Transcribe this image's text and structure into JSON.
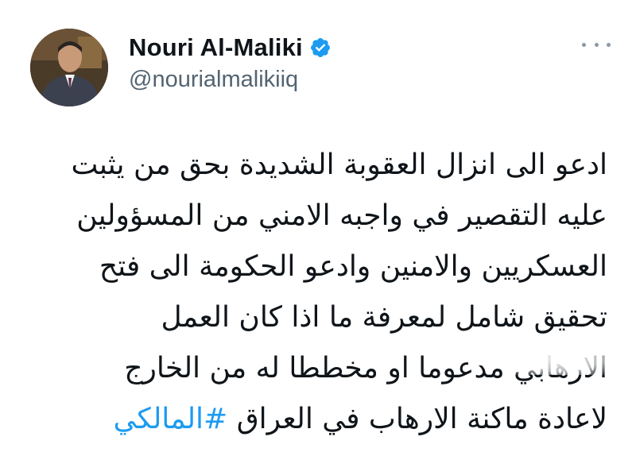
{
  "tweet": {
    "author": {
      "display_name": "Nouri Al-Maliki",
      "handle": "@nourialmalikiiq",
      "verified": true,
      "avatar_icon": "profile-photo"
    },
    "more_icon": "more-horizontal-icon",
    "lines": [
      "ادعو الى انزال العقوبة الشديدة بحق من يثبت",
      "عليه التقصير في واجبه الامني من المسؤولين",
      "العسكريين والامنين وادعو الحكومة الى فتح",
      "تحقيق شامل لمعرفة ما اذا كان العمل",
      "الارهابي مدعوما او مخططا له من الخارج",
      "لاعادة ماكنة الارهاب في العراق"
    ],
    "hashtag": "#المالكي",
    "colors": {
      "hashtag": "#1d9bf0",
      "verified_badge": "#1d9bf0",
      "handle": "#536471",
      "text": "#0f1419"
    }
  }
}
